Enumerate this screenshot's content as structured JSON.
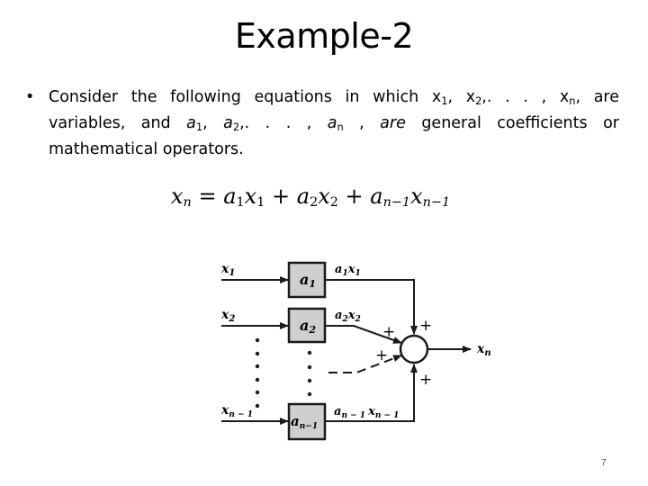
{
  "slide": {
    "title": "Example-2",
    "page_number": "7"
  },
  "bullet": {
    "marker": "•",
    "line1": {
      "pre": "Consider the following equations in which x",
      "s1": "1",
      "mid1": ", x",
      "s2": "2",
      "mid2": ",. . . , x",
      "s3": "n",
      "post": ", are"
    },
    "line2": {
      "pre": "variables, and ",
      "a": "a",
      "s1": "1",
      "sep1": ", ",
      "a2": "a",
      "s2": "2",
      "mid": ",. . . , ",
      "an": "a",
      "s3": "n",
      "mid2": " , ",
      "are": "are",
      "post": " general coefficients or"
    },
    "line3": "mathematical operators."
  },
  "equation": {
    "lhs_var": "x",
    "lhs_sub": "n",
    "equals": " = ",
    "t1_a": "a",
    "t1_as": "1",
    "t1_x": "x",
    "t1_xs": "1",
    "plus": " + ",
    "t2_a": "a",
    "t2_as": "2",
    "t2_x": "x",
    "t2_xs": "2",
    "t3_a": "a",
    "t3_as": "n−1",
    "t3_x": "x",
    "t3_xs": "n−1"
  },
  "diagram": {
    "inputs": [
      {
        "var": "x",
        "sub": "1"
      },
      {
        "var": "x",
        "sub": "2"
      },
      {
        "var": "x",
        "sub": "n − 1"
      }
    ],
    "gains": [
      {
        "var": "a",
        "sub": "1"
      },
      {
        "var": "a",
        "sub": "2"
      },
      {
        "var": "a",
        "sub": "n−1"
      }
    ],
    "products": [
      {
        "a": "a",
        "as": "1",
        "x": "x",
        "xs": "1"
      },
      {
        "a": "a",
        "as": "2",
        "x": "x",
        "xs": "2"
      },
      {
        "a": "a",
        "as": "n − 1",
        "x": "x",
        "xs": "n − 1"
      }
    ],
    "signs": [
      "+",
      "+",
      "+",
      "+"
    ],
    "output": {
      "var": "x",
      "sub": "n"
    },
    "box_fill": "#cfcfcf",
    "stroke": "#1a1a1a"
  }
}
